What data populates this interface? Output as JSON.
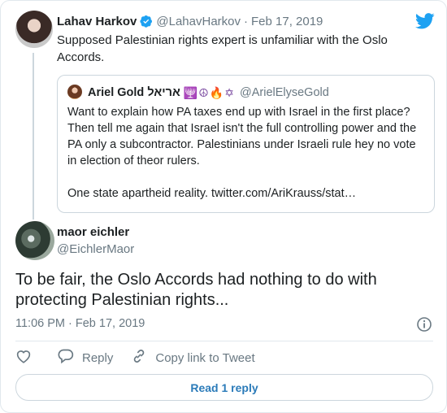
{
  "parent_tweet": {
    "author_name": "Lahav Harkov",
    "author_handle": "@LahavHarkov",
    "date": "Feb 17, 2019",
    "separator": "·",
    "text": "Supposed Palestinian rights expert is unfamiliar with the Oslo Accords."
  },
  "quoted_tweet": {
    "author_name": "Ariel Gold אריאל",
    "author_emoji": "🕎☮🔥✡",
    "author_handle": "@ArielElyseGold",
    "text_line1": "Want to explain how PA taxes end up with Israel in the first place? Then tell me again that Israel isn't the full controlling power and the PA only a subcontractor. Palestinians under Israeli rule hey no vote in election of theor rulers.",
    "text_line2": "One state apartheid reality. twitter.com/AriKrauss/stat…"
  },
  "reply_tweet": {
    "author_name": "maor eichler",
    "author_handle": "@EichlerMaor",
    "text": "To be fair, the Oslo Accords had nothing to do with protecting Palestinian rights...",
    "timestamp": "11:06 PM · Feb 17, 2019"
  },
  "actions": {
    "reply_label": "Reply",
    "copy_link_label": "Copy link to Tweet",
    "read_reply_label": "Read 1 reply"
  },
  "icons": {
    "verified": "verified-badge-icon",
    "twitter": "twitter-bird-icon",
    "info": "info-icon",
    "like": "heart-icon",
    "reply": "reply-icon",
    "link": "link-icon"
  },
  "colors": {
    "accent": "#1da1f2",
    "link_blue": "#2b7bb9",
    "muted_text": "#697882",
    "border": "#e1e8ed"
  }
}
